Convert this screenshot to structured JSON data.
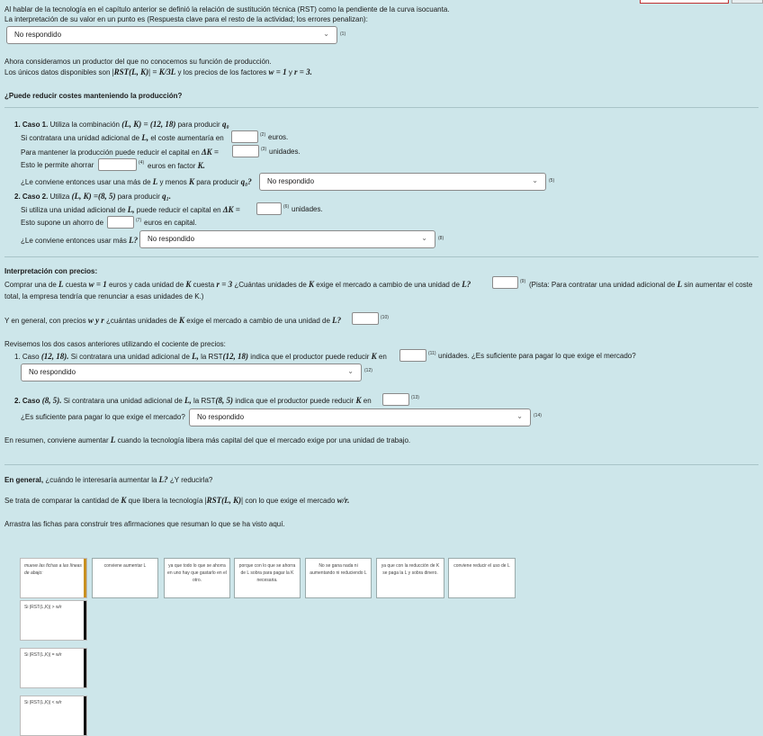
{
  "top_button": {
    "label": ""
  },
  "intro": {
    "line1": "Al hablar de la tecnología en el capítulo anterior se definió la relación de sustitución técnica (RST) como la pendiente de la curva isocuanta.",
    "line2": "La interpretación de su valor en un punto es (Respuesta clave para el resto de la actividad; los errores penalizan):",
    "select1": {
      "value": "No respondido",
      "num": "(1)"
    }
  },
  "context": {
    "line1": "Ahora consideramos un productor del que no conocemos su función de producción.",
    "line2a": "Los únicos datos disponibles son",
    "rst_expr": "|RST(L, K)| = K/3L",
    "line2b": "y los precios de los factores",
    "w_expr": "w = 1",
    "line2c": "y",
    "r_expr": "r = 3."
  },
  "question_title": "¿Puede reducir costes manteniendo la producción?",
  "caso1": {
    "title": "1. Caso 1.",
    "text_a": "Utiliza la combinación",
    "combo": "(L, K) = (12, 18)",
    "text_b": "para producir",
    "q": "q₀",
    "l1": "Si contratara una unidad adicional de",
    "L": "L,",
    "l1b": "el coste aumentaría en",
    "n2": "(2)",
    "l1c": "euros.",
    "l2": "Para mantener la producción puede reducir el capital en",
    "dk": "ΔK =",
    "n3": "(3)",
    "l2b": "unidades.",
    "l3": "Esto le permite ahorrar",
    "n4": "(4)",
    "l3b": "euros en factor",
    "K": "K.",
    "l4": "¿Le conviene entonces usar una más de",
    "l4L": "L",
    "l4b": "y menos",
    "l4K": "K",
    "l4c": "para producir",
    "l4q": "q₀?",
    "select": {
      "value": "No respondido",
      "num": "(5)"
    }
  },
  "caso2": {
    "title": "2. Caso 2.",
    "text_a": "Utiliza",
    "combo": "(L, K) =(8, 5)",
    "text_b": "para producir",
    "q": "q₁.",
    "l1": "Si utiliza una unidad adicional de",
    "L": "L,",
    "l1b": "puede reducir el capital en",
    "dk": "ΔK =",
    "n6": "(6)",
    "l1c": "unidades.",
    "l2": "Esto supone un ahorro de",
    "n7": "(7)",
    "l2b": "euros en capital.",
    "l3": "¿Le conviene entonces usar más",
    "l3L": "L?",
    "select": {
      "value": "No respondido",
      "num": "(8)"
    }
  },
  "precios": {
    "title": "Interpretación con precios:",
    "l1a": "Comprar una de",
    "L": "L",
    "l1b": "cuesta",
    "w": "w = 1",
    "l1c": "euros y cada unidad de",
    "K": "K",
    "l1d": "cuesta",
    "r": "r = 3",
    "l1e": "¿Cuántas unidades de",
    "K2": "K",
    "l1f": "exige el mercado a cambio de una unidad de",
    "L2": "L?",
    "n9": "(9)",
    "l1g": "(Pista: Para contratar una unidad adicional de",
    "L3": "L",
    "l1h": "sin aumentar el coste",
    "l2": "total, la empresa tendría que renunciar a esas unidades de K.)",
    "l3a": "Y en general, con precios",
    "wr": "w y r",
    "l3b": "¿cuántas unidades de",
    "K3": "K",
    "l3c": "exige el mercado a cambio de una unidad de",
    "L4": "L?",
    "n10": "(10)"
  },
  "revisemos": {
    "l1": "Revisemos los dos casos anteriores utilizando el cociente de precios:",
    "c1a": "1. Caso",
    "c1combo": "(12, 18).",
    "c1b": "Si contratara una unidad adicional de",
    "c1L": "L,",
    "c1c": "la RST",
    "c1rst": "(12, 18)",
    "c1d": "indica que el productor puede reducir",
    "c1K": "K",
    "c1e": "en",
    "n11": "(11)",
    "c1f": "unidades. ¿Es suficiente para pagar lo que exige el mercado?",
    "select12": {
      "value": "No respondido",
      "num": "(12)"
    },
    "c2a": "2. Caso",
    "c2combo": "(8, 5).",
    "c2b": "Si contratara una unidad adicional de",
    "c2L": "L,",
    "c2c": "la RST",
    "c2rst": "(8, 5)",
    "c2d": "indica que el productor puede reducir",
    "c2K": "K",
    "c2e": "en",
    "n13": "(13)",
    "c2f": "¿Es suficiente para pagar lo que exige el mercado?",
    "select14": {
      "value": "No respondido",
      "num": "(14)"
    },
    "resumen_a": "En resumen, conviene aumentar",
    "resumen_L": "L",
    "resumen_b": "cuando la tecnología libera más capital del que el mercado exige por una unidad de trabajo."
  },
  "general": {
    "title": "En general,",
    "title_b": "¿cuándo le interesaría aumentar la",
    "L": "L?",
    "title_c": "¿Y reducirla?",
    "l1a": "Se trata de comparar la cantidad de",
    "K": "K",
    "l1b": "que libera la tecnología",
    "rst": "|RST(L, K)|",
    "l1c": "con lo que exige el mercado",
    "wr": "w/r.",
    "l2": "Arrastra las fichas para construir tres afirmaciones que resuman lo que se ha visto aquí."
  },
  "cards": {
    "hint": "mueve las fichas a las líneas de abajo:",
    "items": [
      "conviene aumentar L",
      "ya que todo lo que se ahorra en uno hay que gastarlo en el otro.",
      "porque con lo que se ahorra de L sobra para pagar la K necesaria.",
      "No se gana nada ni aumentando ni reduciendo L",
      "ya que con la reducción de K se paga la L y sobra dinero.",
      "conviene reducir el uso de L"
    ]
  },
  "drop_rows": [
    "Si |RST(L,K)| > w/r",
    "Si |RST(L,K)| = w/r",
    "Si |RST(L,K)| < w/r"
  ]
}
